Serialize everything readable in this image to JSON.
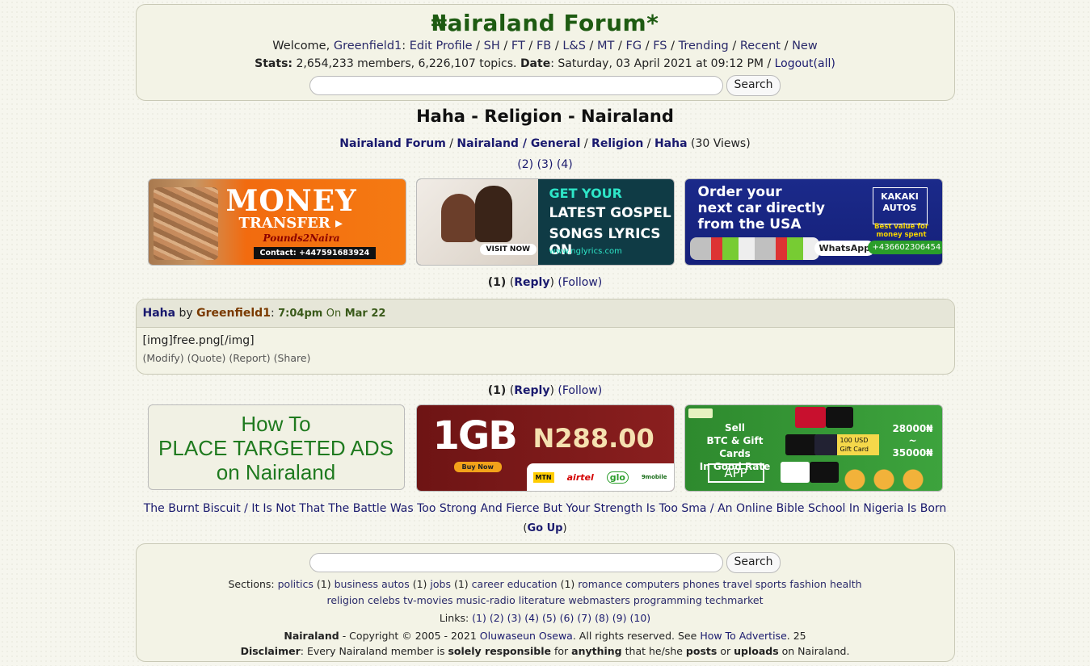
{
  "header": {
    "logo": "₦airaland Forum*",
    "welcome_prefix": "Welcome,",
    "username": "Greenfield1",
    "colon": ":",
    "nav_links": [
      "Edit Profile",
      "SH",
      "FT",
      "FB",
      "L&S",
      "MT",
      "FG",
      "FS",
      "Trending",
      "Recent",
      "New"
    ],
    "stats_label": "Stats:",
    "stats_text": "2,654,233 members, 6,226,107 topics.",
    "date_label": "Date",
    "date_text": ": Saturday, 03 April 2021 at 09:12 PM /",
    "logout": "Logout",
    "logout_all": "(all)",
    "search_button": "Search"
  },
  "page": {
    "title": "Haha - Religion - Nairaland",
    "breadcrumb": [
      "Nairaland Forum",
      "Nairaland / General",
      "Religion",
      "Haha"
    ],
    "views": "(30 Views)",
    "pages": [
      "(2)",
      "(3)",
      "(4)"
    ]
  },
  "ads_top": {
    "money": {
      "line1": "MONEY",
      "line2": "TRANSFER ▸",
      "brand": "Pounds2Naira",
      "contact": "Contact: +447591683924"
    },
    "gospel": {
      "line1": "GET YOUR",
      "line2": "LATEST GOSPEL",
      "line3": "SONGS LYRICS ON",
      "url": "www.nglyrics.com",
      "visit": "VISIT NOW"
    },
    "kakaki": {
      "line1": "Order your",
      "line2": "next car directly",
      "line3": "from the USA",
      "brand1": "KAKAKI",
      "brand2": "AUTOS",
      "tag": "Best value for money spent",
      "whatsapp": "WhatsApp",
      "phone": "+436602306454"
    }
  },
  "reply_row": {
    "num": "(1)",
    "reply": "Reply",
    "follow": "(Follow)"
  },
  "post": {
    "title": "Haha",
    "by": "by",
    "user": "Greenfield1",
    "time": "7:04pm",
    "on": "On",
    "date": "Mar 22",
    "body": "[img]free.png[/img]",
    "actions": [
      "(Modify)",
      "(Quote)",
      "(Report)",
      "(Share)"
    ]
  },
  "ads_bottom": {
    "targeted": {
      "line1": "How To",
      "line2": "PLACE TARGETED ADS",
      "line3": "on Nairaland"
    },
    "data": {
      "size": "1GB",
      "price": "N288.00",
      "buy": "Buy Now",
      "networks": [
        "MTN",
        "airtel",
        "glo",
        "9mobile"
      ]
    },
    "btc": {
      "line1": "Sell",
      "line2": "BTC & Gift Cards",
      "line3": "In Good Rate",
      "app": "APP",
      "card": "100 USD Gift Card",
      "rate1": "28000₦",
      "tilde": "~",
      "rate2": "35000₦"
    }
  },
  "related": [
    "The Burnt Biscuit",
    "It Is Not That The Battle Was Too Strong And Fierce But Your Strength Is Too Sma",
    "An Online Bible School In Nigeria Is Born"
  ],
  "goup": "Go Up",
  "footer": {
    "search_button": "Search",
    "sections_label": "Sections:",
    "sections_line1": [
      {
        "name": "politics",
        "count": "(1)"
      },
      {
        "name": "business",
        "count": ""
      },
      {
        "name": "autos",
        "count": "(1)"
      },
      {
        "name": "jobs",
        "count": "(1)"
      },
      {
        "name": "career",
        "count": ""
      },
      {
        "name": "education",
        "count": "(1)"
      },
      {
        "name": "romance",
        "count": ""
      },
      {
        "name": "computers",
        "count": ""
      },
      {
        "name": "phones",
        "count": ""
      },
      {
        "name": "travel",
        "count": ""
      },
      {
        "name": "sports",
        "count": ""
      },
      {
        "name": "fashion",
        "count": ""
      },
      {
        "name": "health",
        "count": ""
      }
    ],
    "sections_line2": [
      "religion",
      "celebs",
      "tv-movies",
      "music-radio",
      "literature",
      "webmasters",
      "programming",
      "techmarket"
    ],
    "links_label": "Links:",
    "links": [
      "(1)",
      "(2)",
      "(3)",
      "(4)",
      "(5)",
      "(6)",
      "(7)",
      "(8)",
      "(9)",
      "(10)"
    ],
    "copyright_brand": "Nairaland",
    "copyright_text": "- Copyright © 2005 - 2021",
    "copyright_owner": "Oluwaseun Osewa",
    "copyright_rest": ". All rights reserved. See",
    "advertise": "How To Advertise",
    "advertise_num": ". 25",
    "disclaimer_label": "Disclaimer",
    "disclaimer_1": ": Every Nairaland member is",
    "disclaimer_b1": "solely responsible",
    "disclaimer_2": "for",
    "disclaimer_b2": "anything",
    "disclaimer_3": "that he/she",
    "disclaimer_b3": "posts",
    "disclaimer_4": "or",
    "disclaimer_b4": "uploads",
    "disclaimer_5": "on Nairaland."
  },
  "colors": {
    "logo": "#1e5b12",
    "link": "#1a1a6e",
    "box": "#f3f3e6"
  }
}
